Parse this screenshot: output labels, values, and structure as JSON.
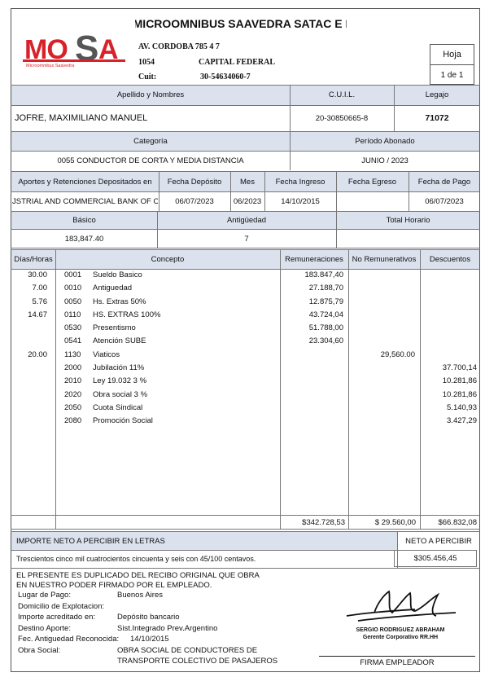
{
  "company": {
    "name": "MICROOMNIBUS SAAVEDRA SATAC E I",
    "logo_text": "MOSA",
    "logo_subtext": "Microomnibus Saavedra",
    "address": "AV. CORDOBA  785  4  7",
    "postal_code": "1054",
    "city": "CAPITAL FEDERAL",
    "cuit_label": "Cuit:",
    "cuit": "30-54634060-7"
  },
  "sheet": {
    "label": "Hoja",
    "value": "1 de 1"
  },
  "employee": {
    "name_label": "Apellido y Nombres",
    "name": "JOFRE, MAXIMILIANO MANUEL",
    "cuil_label": "C.U.I.L.",
    "cuil": "20-30850665-8",
    "legajo_label": "Legajo",
    "legajo": "71072",
    "category_label": "Categoría",
    "category": "0055 CONDUCTOR DE CORTA Y MEDIA DISTANCIA",
    "period_label": "Período Abonado",
    "period": "JUNIO / 2023"
  },
  "deposit": {
    "headers": [
      "Aportes y Retenciones Depositados en",
      "Fecha Depósito",
      "Mes",
      "Fecha Ingreso",
      "Fecha Egreso",
      "Fecha de Pago"
    ],
    "values": [
      "JSTRIAL AND COMMERCIAL BANK OF CI",
      "06/07/2023",
      "06/2023",
      "14/10/2015",
      "",
      "06/07/2023"
    ]
  },
  "salary": {
    "basic_label": "Básico",
    "basic": "183,847.40",
    "seniority_label": "Antigüedad",
    "seniority": "7",
    "hours_label": "Total Horario",
    "hours": ""
  },
  "items_header": {
    "days": "Días/Horas",
    "concept": "Concepto",
    "remun": "Remuneraciones",
    "no_remun": "No Remunerativos",
    "deductions": "Descuentos"
  },
  "items": [
    {
      "qty": "30.00",
      "code": "0001",
      "desc": "Sueldo Basico",
      "remun": "183.847,40",
      "no_remun": "",
      "ded": ""
    },
    {
      "qty": "7.00",
      "code": "0010",
      "desc": "Antiguedad",
      "remun": "27.188,70",
      "no_remun": "",
      "ded": ""
    },
    {
      "qty": "5.76",
      "code": "0050",
      "desc": "Hs. Extras 50%",
      "remun": "12.875,79",
      "no_remun": "",
      "ded": ""
    },
    {
      "qty": "14.67",
      "code": "0110",
      "desc": "HS. EXTRAS 100%",
      "remun": "43.724,04",
      "no_remun": "",
      "ded": ""
    },
    {
      "qty": "",
      "code": "0530",
      "desc": "Presentismo",
      "remun": "51.788,00",
      "no_remun": "",
      "ded": ""
    },
    {
      "qty": "",
      "code": "0541",
      "desc": "Atención SUBE",
      "remun": "23.304,60",
      "no_remun": "",
      "ded": ""
    },
    {
      "qty": "20.00",
      "code": "1130",
      "desc": "Viaticos",
      "remun": "",
      "no_remun": "29,560.00",
      "ded": ""
    },
    {
      "qty": "",
      "code": "2000",
      "desc": "Jubilación 11%",
      "remun": "",
      "no_remun": "",
      "ded": "37.700,14"
    },
    {
      "qty": "",
      "code": "2010",
      "desc": "Ley 19.032  3 %",
      "remun": "",
      "no_remun": "",
      "ded": "10.281,86"
    },
    {
      "qty": "",
      "code": "2020",
      "desc": "Obra social 3 %",
      "remun": "",
      "no_remun": "",
      "ded": "10.281,86"
    },
    {
      "qty": "",
      "code": "2050",
      "desc": "Cuota Sindical",
      "remun": "",
      "no_remun": "",
      "ded": "5.140,93"
    },
    {
      "qty": "",
      "code": "2080",
      "desc": "Promoción Social",
      "remun": "",
      "no_remun": "",
      "ded": "3.427,29"
    }
  ],
  "totals": {
    "remun": "$342.728,53",
    "no_remun": "$ 29.560,00",
    "ded": "$66.832,08"
  },
  "net": {
    "words_label": "IMPORTE NETO A PERCIBIR EN LETRAS",
    "words": "Trescientos cinco mil cuatrocientos cincuenta y seis con 45/100 centavos.",
    "label": "NETO A PERCIBIR",
    "amount": "$305.456,45"
  },
  "footer": {
    "notice_1": "EL PRESENTE ES DUPLICADO DEL RECIBO ORIGINAL QUE OBRA",
    "notice_2": "EN NUESTRO PODER FIRMADO POR EL EMPLEADO.",
    "fields": [
      {
        "label": "Lugar de Pago:",
        "value": "Buenos Aires"
      },
      {
        "label": "Domicilio de Explotacion:",
        "value": ""
      },
      {
        "label": "Importe acreditado en:",
        "value": "Depósito bancario"
      },
      {
        "label": "Destino Aporte:",
        "value": "Sist.Integrado Prev.Argentino"
      },
      {
        "label": "Fec. Antiguedad Reconocida:",
        "value": "14/10/2015"
      },
      {
        "label": "Obra Social:",
        "value": "OBRA SOCIAL DE CONDUCTORES DE"
      },
      {
        "label": "",
        "value": "TRANSPORTE COLECTIVO DE PASAJEROS"
      }
    ],
    "signer_name": "SERGIO RODRIGUEZ ABRAHAM",
    "signer_title": "Gerente Corporativo RR.HH",
    "signature_label": "FIRMA EMPLEADOR"
  },
  "colors": {
    "header_fill": "#dbe2ee",
    "logo_red": "#d8222a",
    "logo_gray": "#555555"
  }
}
